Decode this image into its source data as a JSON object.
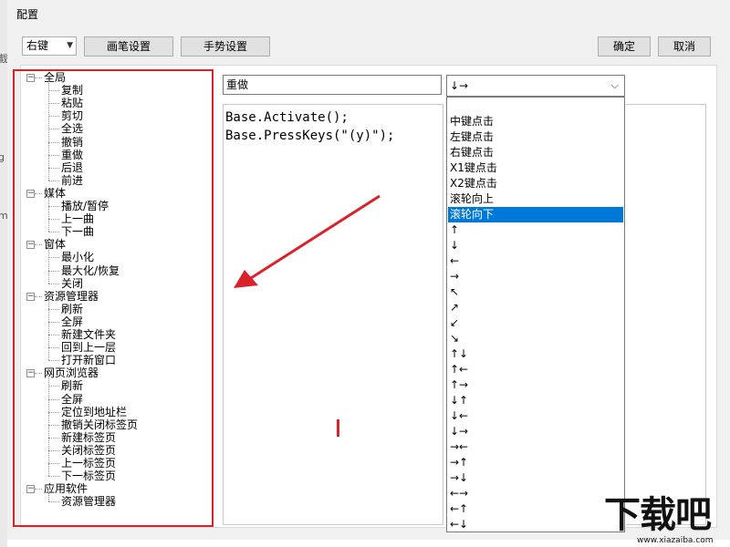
{
  "window": {
    "title": "配置"
  },
  "toolbar": {
    "mode": "右键",
    "pen_settings": "画笔设置",
    "gesture_settings": "手势设置",
    "ok": "确定",
    "cancel": "取消"
  },
  "background": {
    "glyphs": [
      "截",
      "g",
      "m"
    ]
  },
  "tree": {
    "groups": [
      {
        "label": "全局",
        "items": [
          "复制",
          "粘贴",
          "剪切",
          "全选",
          "撤销",
          "重做",
          "后退",
          "前进"
        ]
      },
      {
        "label": "媒体",
        "items": [
          "播放/暂停",
          "上一曲",
          "下一曲"
        ]
      },
      {
        "label": "窗体",
        "items": [
          "最小化",
          "最大化/恢复",
          "关闭"
        ]
      },
      {
        "label": "资源管理器",
        "items": [
          "刷新",
          "全屏",
          "新建文件夹",
          "回到上一层",
          "打开新窗口"
        ]
      },
      {
        "label": "网页浏览器",
        "items": [
          "刷新",
          "全屏",
          "定位到地址栏",
          "撤销关闭标签页",
          "新建标签页",
          "关闭标签页",
          "上一标签页",
          "下一标签页"
        ]
      },
      {
        "label": "应用软件",
        "items": [
          "资源管理器"
        ]
      }
    ],
    "expanded_symbol": "−"
  },
  "editor": {
    "name_value": "重做",
    "gesture_value": "↓→",
    "dropdown_arrow": "⌵",
    "code_lines": [
      "Base.Activate();",
      "Base.PressKeys(\"(y)\");"
    ]
  },
  "dropdown": {
    "selected_index": 6,
    "options": [
      "中键点击",
      "左键点击",
      "右键点击",
      "X1键点击",
      "X2键点击",
      "滚轮向上",
      "滚轮向下",
      "↑",
      "↓",
      "←",
      "→",
      "↖",
      "↗",
      "↙",
      "↘",
      "↑↓",
      "↑←",
      "↑→",
      "↓↑",
      "↓←",
      "↓→",
      "→←",
      "→↑",
      "→↓",
      "←→",
      "←↑",
      "←↓"
    ]
  },
  "watermark": {
    "text": "下载吧",
    "url": "www.xiazaiba.com"
  },
  "colors": {
    "highlight": "#0078d7",
    "annotation_red": "#d9232a"
  }
}
